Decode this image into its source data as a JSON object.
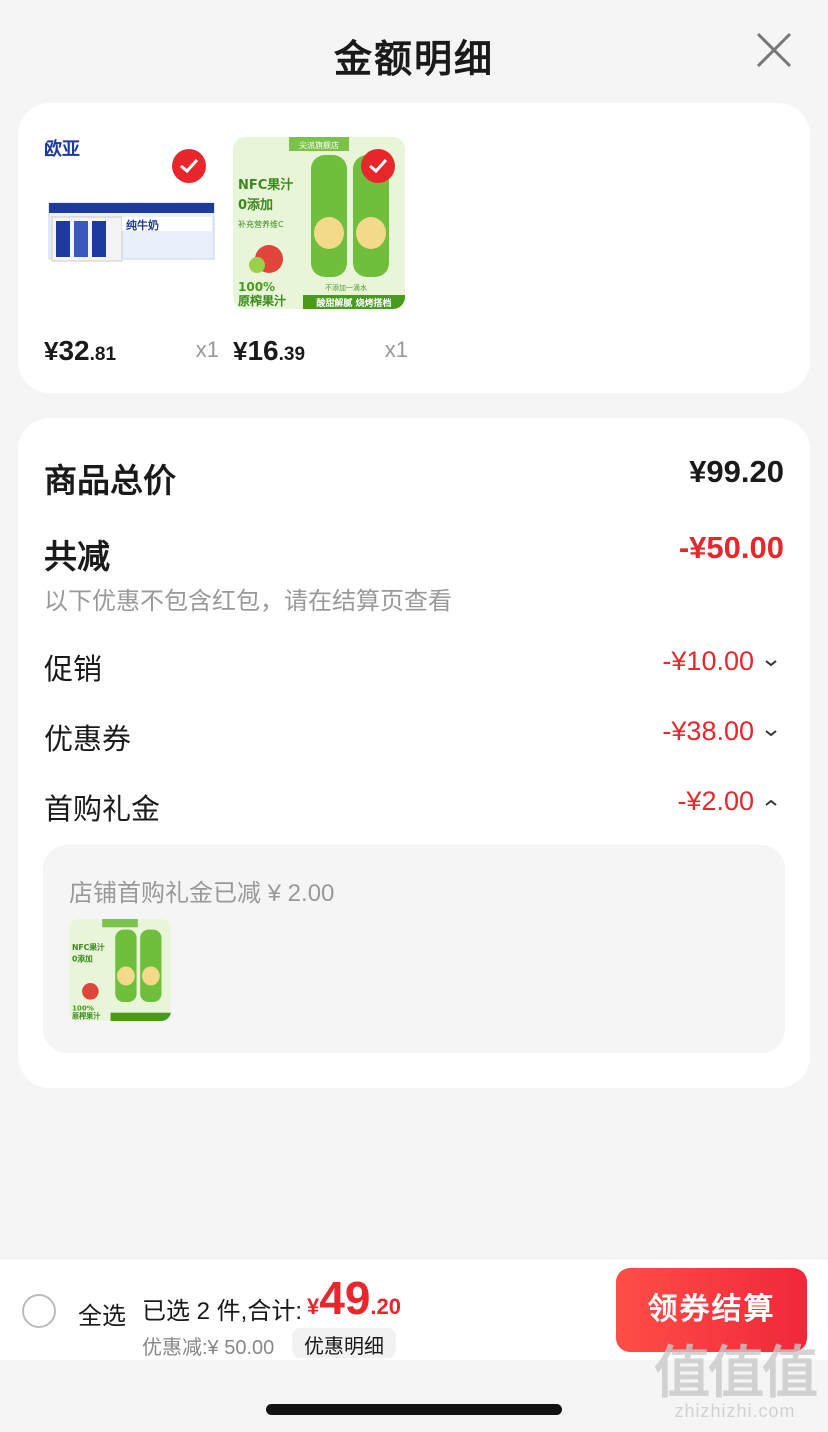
{
  "header": {
    "title": "金额明细"
  },
  "products": [
    {
      "price_currency": "¥",
      "price_int": "32",
      "price_dec": ".81",
      "qty": "x1",
      "brand_text": "欧亚",
      "sub_text": "纯牛奶"
    },
    {
      "price_currency": "¥",
      "price_int": "16",
      "price_dec": ".39",
      "qty": "x1",
      "badge": "尖派旗舰店",
      "line1": "NFC果汁",
      "line2": "0添加",
      "line3": "补充营养维C",
      "line4": "100%",
      "line5": "原榨果汁",
      "line6": "不添加一滴水",
      "line7": "酸甜解腻 烧烤搭档"
    }
  ],
  "details": {
    "total_label": "商品总价",
    "total_amount": "¥99.20",
    "reduce_label": "共减",
    "reduce_amount": "-¥50.00",
    "reduce_note": "以下优惠不包含红包，请在结算页查看",
    "promo_label": "促销",
    "promo_amount": "-¥10.00",
    "coupon_label": "优惠券",
    "coupon_amount": "-¥38.00",
    "gift_label": "首购礼金",
    "gift_amount": "-¥2.00",
    "gift_note": "店铺首购礼金已减 ¥ 2.00"
  },
  "bottom": {
    "select_all": "全选",
    "selected_text": "已选 2 件,合计:",
    "total_currency": "¥",
    "total_int": "49",
    "total_dec": ".20",
    "saved_text": "优惠减:¥ 50.00",
    "detail_link": "优惠明细",
    "checkout": "领券结算"
  },
  "watermark": {
    "big": "值值值",
    "small": "zhizhizhi.com"
  },
  "colors": {
    "accent": "#e8262b",
    "background": "#f5f5f5"
  }
}
